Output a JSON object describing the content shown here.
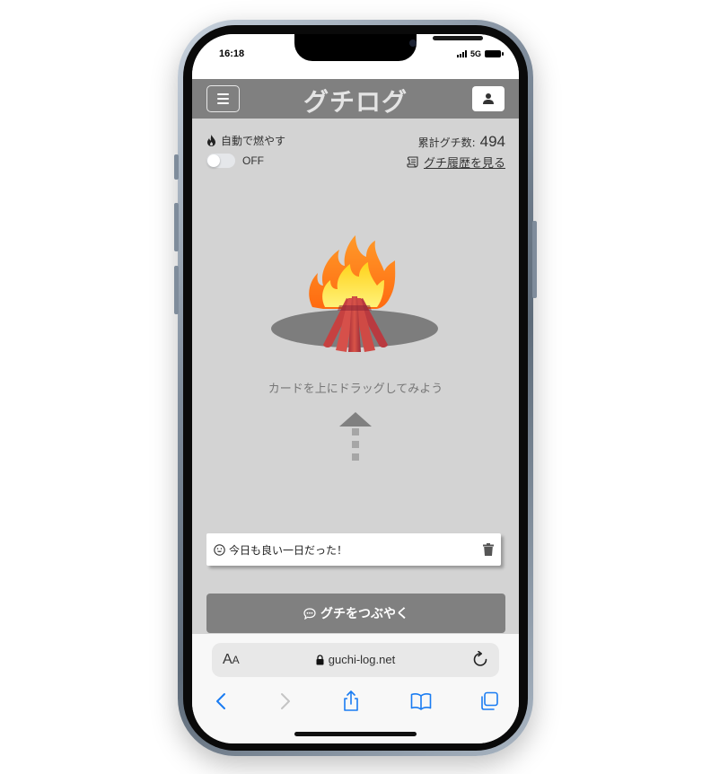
{
  "status_bar": {
    "time": "16:18",
    "network": "5G"
  },
  "header": {
    "title": "グチログ"
  },
  "auto_burn": {
    "label": "自動で燃やす",
    "toggle_state": "OFF",
    "enabled": false
  },
  "stats": {
    "total_label": "累計グチ数:",
    "total_value": "494",
    "history_link": "グチ履歴を見る"
  },
  "drag_hint": "カードを上にドラッグしてみよう",
  "card": {
    "text": "今日も良い一日だった！"
  },
  "post_button": {
    "label": "グチをつぶやく"
  },
  "browser": {
    "text_size_label_big": "A",
    "text_size_label_small": "A",
    "url": "guchi-log.net"
  },
  "colors": {
    "header_bg": "#808080",
    "main_bg": "#d3d3d3",
    "button_bg": "#808080",
    "safari_accent": "#1a7cf2",
    "fire_outer": "#ff7a1a",
    "fire_inner": "#ffe23a",
    "log": "#c6463f"
  },
  "icons": {
    "menu": "hamburger-icon",
    "user": "user-icon",
    "fire": "flame-icon",
    "history": "scroll-icon",
    "card": "smile-icon",
    "delete": "trash-icon",
    "post": "chat-bubble-icon",
    "lock": "lock-icon",
    "reload": "reload-icon",
    "back": "chevron-left-icon",
    "forward": "chevron-right-icon",
    "share": "share-icon",
    "bookmarks": "book-icon",
    "tabs": "tabs-icon"
  }
}
